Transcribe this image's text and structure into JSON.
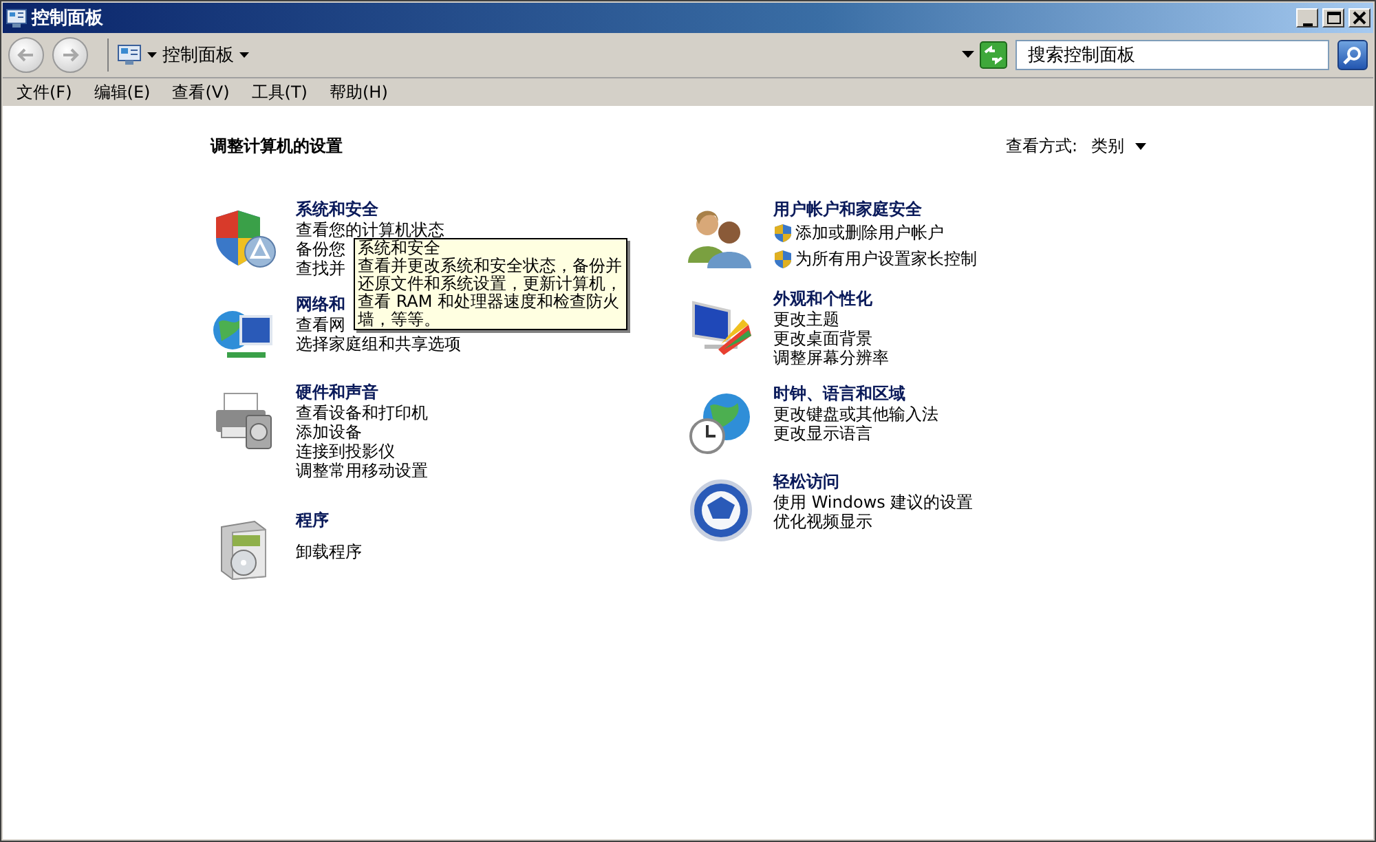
{
  "window": {
    "title": "控制面板"
  },
  "address_bar": {
    "path": "控制面板"
  },
  "search": {
    "placeholder": "搜索控制面板"
  },
  "menu": [
    "文件(F)",
    "编辑(E)",
    "查看(V)",
    "工具(T)",
    "帮助(H)"
  ],
  "heading": "调整计算机的设置",
  "view_by": {
    "label": "查看方式:",
    "value": "类别"
  },
  "columns": [
    [
      {
        "title": "系统和安全",
        "links": [
          {
            "text": "查看您的计算机状态",
            "shield": false
          },
          {
            "text": "备份您",
            "shield": false
          },
          {
            "text": "查找并",
            "shield": false
          }
        ]
      },
      {
        "title": "网络和",
        "links": [
          {
            "text": "查看网",
            "shield": false
          },
          {
            "text": "选择家庭组和共享选项",
            "shield": false
          }
        ]
      },
      {
        "title": "硬件和声音",
        "links": [
          {
            "text": "查看设备和打印机",
            "shield": false
          },
          {
            "text": "添加设备",
            "shield": false
          },
          {
            "text": "连接到投影仪",
            "shield": false
          },
          {
            "text": "调整常用移动设置",
            "shield": false
          }
        ]
      },
      {
        "title": "程序",
        "links": [
          {
            "text": "卸载程序",
            "shield": false
          }
        ]
      }
    ],
    [
      {
        "title": "用户帐户和家庭安全",
        "links": [
          {
            "text": "添加或删除用户帐户",
            "shield": true
          },
          {
            "text": "为所有用户设置家长控制",
            "shield": true
          }
        ]
      },
      {
        "title": "外观和个性化",
        "links": [
          {
            "text": "更改主题",
            "shield": false
          },
          {
            "text": "更改桌面背景",
            "shield": false
          },
          {
            "text": "调整屏幕分辨率",
            "shield": false
          }
        ]
      },
      {
        "title": "时钟、语言和区域",
        "links": [
          {
            "text": "更改键盘或其他输入法",
            "shield": false
          },
          {
            "text": "更改显示语言",
            "shield": false
          }
        ]
      },
      {
        "title": "轻松访问",
        "links": [
          {
            "text": "使用 Windows 建议的设置",
            "shield": false
          },
          {
            "text": "优化视频显示",
            "shield": false
          }
        ]
      }
    ]
  ],
  "tooltip": {
    "title": "系统和安全",
    "text": "查看并更改系统和安全状态，备份并还原文件和系统设置，更新计算机，查看 RAM 和处理器速度和检查防火墙，等等。"
  }
}
